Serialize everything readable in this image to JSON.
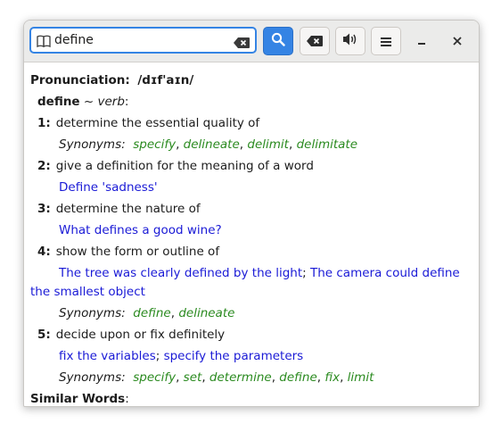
{
  "search": {
    "value": "define"
  },
  "content": {
    "pronunciation_label": "Pronunciation",
    "pronunciation_value": "/dɪf'aɪn/",
    "headword": "define",
    "separator": "~",
    "pos": "verb",
    "senses": [
      {
        "num": "1:",
        "text": "determine the essential quality of",
        "synonyms_label": "Synonyms:",
        "synonyms": [
          "specify",
          "delineate",
          "delimit",
          "delimitate"
        ]
      },
      {
        "num": "2:",
        "text": "give a definition for the meaning of a word",
        "examples": [
          "Define 'sadness'"
        ]
      },
      {
        "num": "3:",
        "text": "determine the nature of",
        "examples": [
          "What defines a good wine?"
        ]
      },
      {
        "num": "4:",
        "text": "show the form or outline of",
        "examples": [
          "The tree was clearly defined by the light",
          "The camera could define the smallest object"
        ],
        "synonyms_label": "Synonyms:",
        "synonyms": [
          "define",
          "delineate"
        ]
      },
      {
        "num": "5:",
        "text": "decide upon or fix definitely",
        "examples": [
          "fix the variables",
          "specify the parameters"
        ],
        "synonyms_label": "Synonyms:",
        "synonyms": [
          "specify",
          "set",
          "determine",
          "define",
          "fix",
          "limit"
        ]
      }
    ],
    "similar_label": "Similar Words"
  },
  "icons": {
    "search_field": "book-icon",
    "clear": "clear-text-icon",
    "search": "search-icon",
    "backspace": "backspace-icon",
    "audio": "speaker-icon",
    "menu": "hamburger-menu-icon",
    "minimize": "minimize-icon",
    "close": "close-icon"
  },
  "colors": {
    "accent": "#3584e4",
    "synonym": "#2a8a1f",
    "example": "#1a1ad6"
  }
}
